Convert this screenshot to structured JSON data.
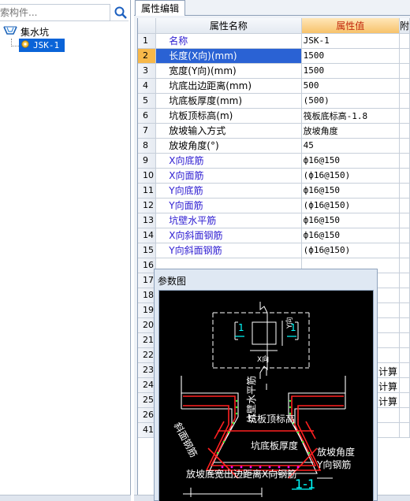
{
  "search": {
    "placeholder": "索构件..."
  },
  "tree": {
    "root_label": "集水坑",
    "child_label": "JSK-1"
  },
  "tab": {
    "label": "属性编辑"
  },
  "grid": {
    "headers": {
      "name": "属性名称",
      "value": "属性值",
      "extra": "附"
    },
    "rows": [
      {
        "num": "1",
        "name": "名称",
        "value": "JSK-1",
        "blue": true
      },
      {
        "num": "2",
        "name": "长度(X向)(mm)",
        "value": "1500",
        "blue": true,
        "selected": true
      },
      {
        "num": "3",
        "name": "宽度(Y向)(mm)",
        "value": "1500",
        "blue": false
      },
      {
        "num": "4",
        "name": "坑底出边距离(mm)",
        "value": "500",
        "blue": false
      },
      {
        "num": "5",
        "name": "坑底板厚度(mm)",
        "value": "(500)",
        "blue": false
      },
      {
        "num": "6",
        "name": "坑板顶标高(m)",
        "value": "筏板底标高-1.8",
        "blue": false
      },
      {
        "num": "7",
        "name": "放坡输入方式",
        "value": "放坡角度",
        "blue": false
      },
      {
        "num": "8",
        "name": "放坡角度(°)",
        "value": "45",
        "blue": false
      },
      {
        "num": "9",
        "name": "X向底筋",
        "value": "ф16@150",
        "blue": true
      },
      {
        "num": "10",
        "name": "X向面筋",
        "value": "(ф16@150)",
        "blue": true
      },
      {
        "num": "11",
        "name": "Y向底筋",
        "value": "ф16@150",
        "blue": true
      },
      {
        "num": "12",
        "name": "Y向面筋",
        "value": "(ф16@150)",
        "blue": true
      },
      {
        "num": "13",
        "name": "坑壁水平筋",
        "value": "ф16@150",
        "blue": true
      },
      {
        "num": "14",
        "name": "X向斜面钢筋",
        "value": "ф16@150",
        "blue": true
      },
      {
        "num": "15",
        "name": "Y向斜面钢筋",
        "value": "(ф16@150)",
        "blue": true
      },
      {
        "num": "16",
        "name": "",
        "value": "",
        "blue": false
      },
      {
        "num": "17",
        "name": "",
        "value": "",
        "blue": false
      },
      {
        "num": "18",
        "name": "",
        "value": "",
        "blue": false
      },
      {
        "num": "19",
        "name": "",
        "value": "",
        "blue": false
      },
      {
        "num": "20",
        "name": "",
        "value": "",
        "blue": false
      },
      {
        "num": "21",
        "name": "",
        "value": "",
        "blue": false
      },
      {
        "num": "22",
        "name": "",
        "value": "",
        "blue": false
      },
      {
        "num": "23",
        "name": "",
        "value": "",
        "blue": false,
        "extra": "计算"
      },
      {
        "num": "24",
        "name": "",
        "value": "",
        "blue": false,
        "extra": "计算"
      },
      {
        "num": "25",
        "name": "",
        "value": "",
        "blue": false,
        "extra": "计算"
      },
      {
        "num": "26",
        "name": "",
        "value": "",
        "blue": false
      },
      {
        "num": "41",
        "name": "",
        "value": "",
        "blue": false
      }
    ]
  },
  "popup": {
    "title": "参数图",
    "labels": {
      "section_x": "1",
      "section_y": "1",
      "dim_x": "X向",
      "dim_y": "Y向",
      "wall_rebar": "坑壁水平筋",
      "top_elev": "坑板顶标高",
      "bottom_thk": "坑底板厚度",
      "slope_rebar": "斜面钢筋",
      "slope_angle": "放坡角度",
      "y_rebar": "Y向钢筋",
      "x_rebar": "X向钢筋",
      "bottom_edge": "放坡底宽出边距离",
      "section_name": "1-1"
    }
  },
  "colors": {
    "selection": "#2a62d4",
    "header_value": "#f7c26b",
    "cad_red": "#ff2020",
    "cad_cyan": "#00ffff",
    "cad_magenta": "#ff00ff",
    "cad_green": "#33ff33"
  }
}
